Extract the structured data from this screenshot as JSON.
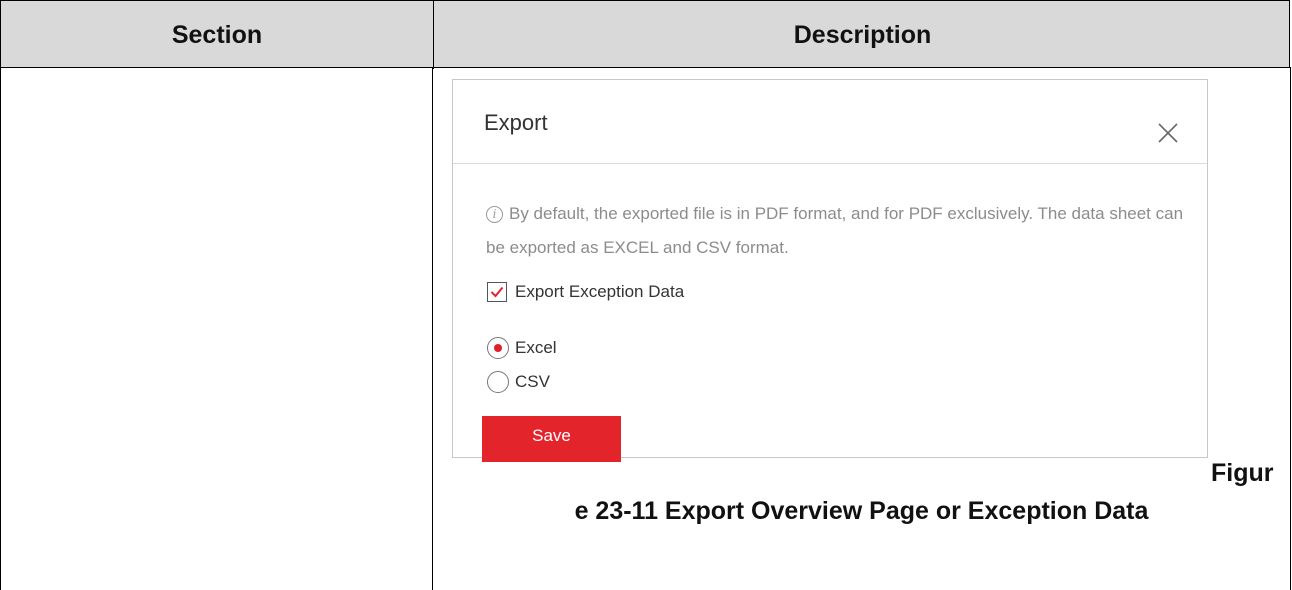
{
  "table": {
    "headers": {
      "section": "Section",
      "description": "Description"
    }
  },
  "dialog": {
    "title": "Export",
    "close_icon": "close-icon",
    "info_icon": "info-icon",
    "info_text": "By default, the exported file is in PDF format, and for PDF exclusively. The data sheet can be exported as EXCEL and CSV format.",
    "checkbox": {
      "label": "Export Exception Data",
      "checked": true
    },
    "format_options": [
      {
        "label": "Excel",
        "selected": true
      },
      {
        "label": "CSV",
        "selected": false
      }
    ],
    "save_label": "Save"
  },
  "caption": {
    "line1": "Figur",
    "line2": "e 23-11 Export Overview Page or Exception Data"
  },
  "colors": {
    "accent": "#e3242b",
    "header_bg": "#d9d9d9"
  }
}
